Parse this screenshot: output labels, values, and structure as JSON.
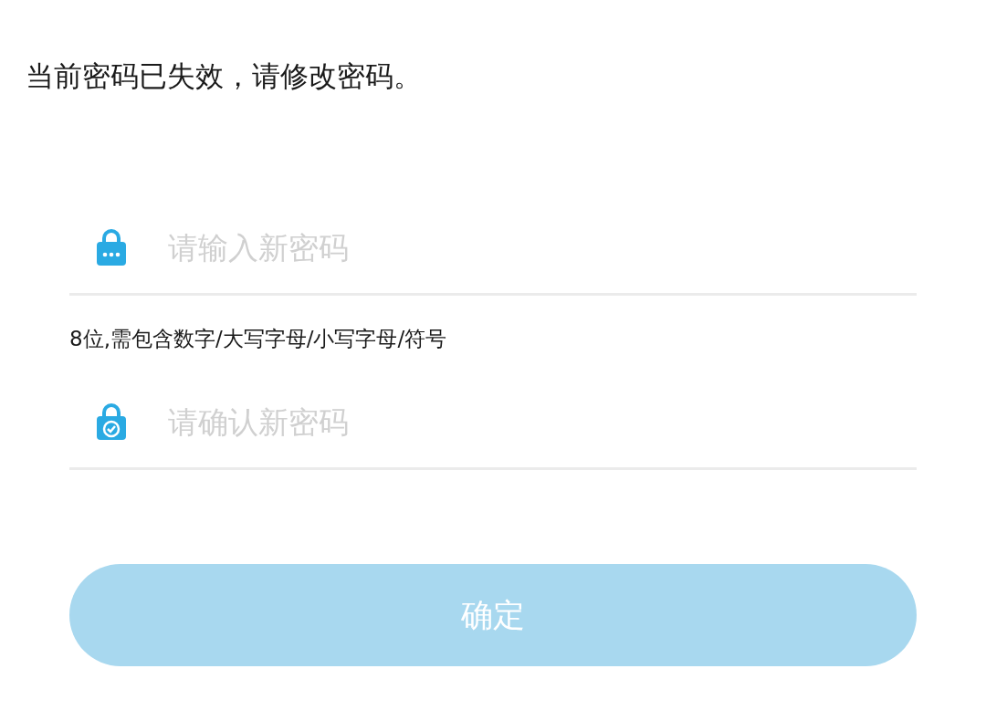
{
  "message": "当前密码已失效，请修改密码。",
  "fields": [
    {
      "kind": "password",
      "placeholder": "请输入新密码",
      "hint": "8位,需包含数字/大写字母/小写字母/符号"
    },
    {
      "kind": "confirm",
      "placeholder": "请确认新密码"
    }
  ],
  "submit": {
    "label": "确定",
    "disabled": true
  }
}
